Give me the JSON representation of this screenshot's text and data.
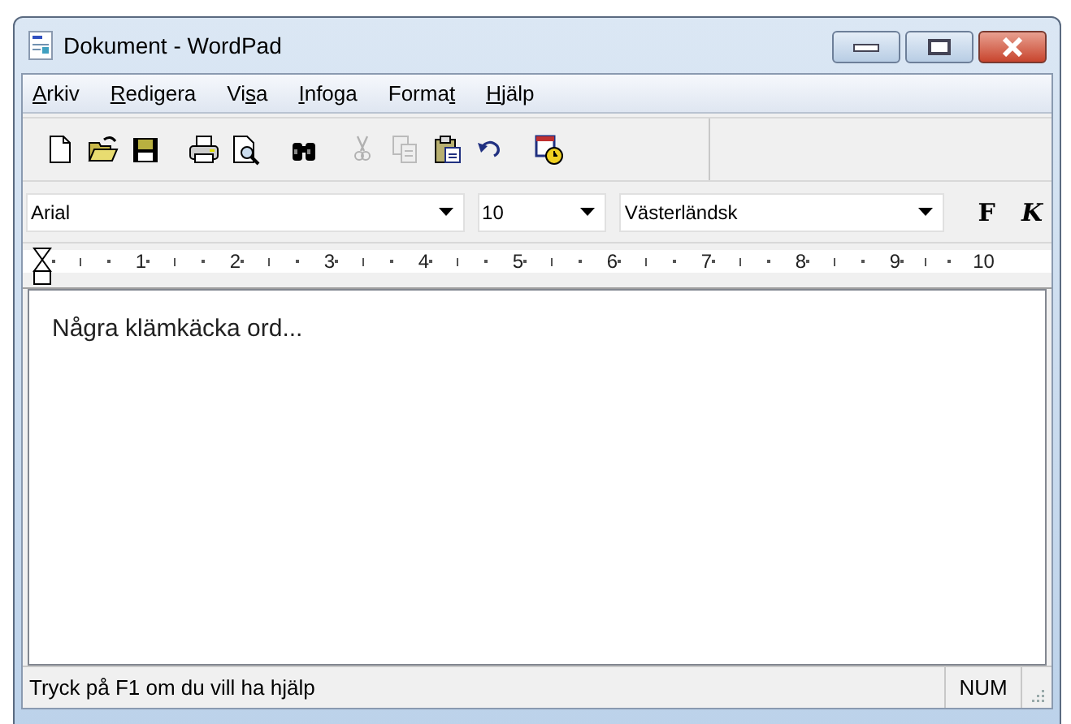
{
  "window": {
    "title": "Dokument - WordPad"
  },
  "menu": [
    {
      "key": "A",
      "after": "rkiv"
    },
    {
      "key": "R",
      "after": "edigera"
    },
    {
      "before": "Vi",
      "key": "s",
      "after": "a"
    },
    {
      "key": "I",
      "after": "nfoga"
    },
    {
      "before": "Forma",
      "key": "t"
    },
    {
      "key": "H",
      "after": "jälp"
    }
  ],
  "toolbar": [
    {
      "kind": "new",
      "disabled": false
    },
    {
      "kind": "open",
      "disabled": false
    },
    {
      "kind": "save",
      "disabled": false
    },
    {
      "kind": "gap"
    },
    {
      "kind": "print",
      "disabled": false
    },
    {
      "kind": "preview",
      "disabled": false
    },
    {
      "kind": "gap"
    },
    {
      "kind": "find",
      "disabled": false
    },
    {
      "kind": "gap"
    },
    {
      "kind": "cut",
      "disabled": true
    },
    {
      "kind": "copy",
      "disabled": true
    },
    {
      "kind": "paste",
      "disabled": false
    },
    {
      "kind": "undo",
      "disabled": false
    },
    {
      "kind": "gap"
    },
    {
      "kind": "datetime",
      "disabled": false
    }
  ],
  "format_bar": {
    "font": "Arial",
    "size": "10",
    "script": "Västerländsk",
    "bold": "F",
    "italic": "K"
  },
  "ruler": [
    "1",
    "2",
    "3",
    "4",
    "5",
    "6",
    "7",
    "8",
    "9",
    "10"
  ],
  "document": {
    "text": "Några klämkäcka ord..."
  },
  "status_bar": {
    "text": "Tryck på F1 om du vill ha hjälp",
    "indicator": "NUM"
  }
}
